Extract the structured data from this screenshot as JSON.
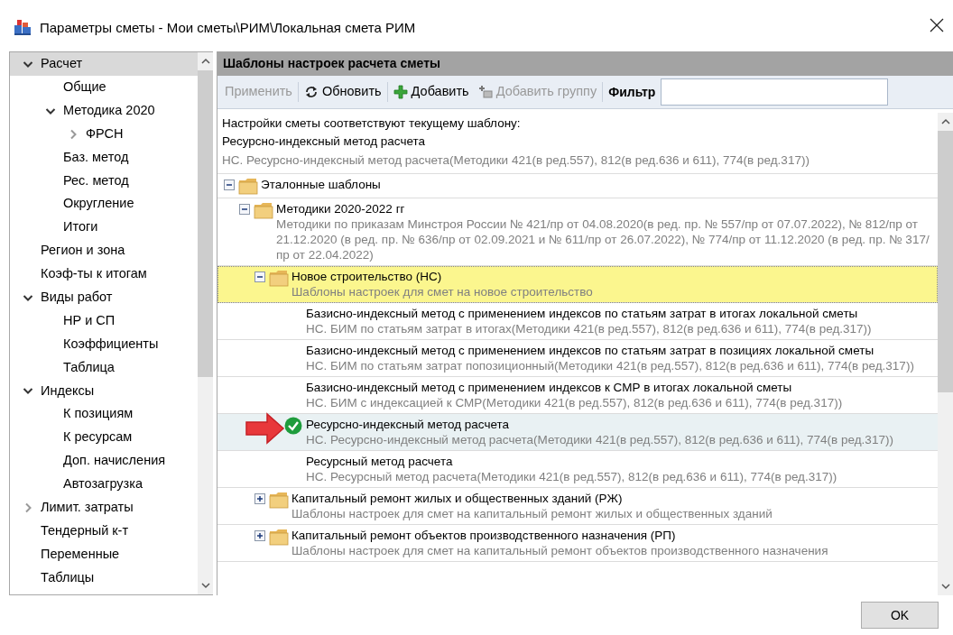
{
  "window": {
    "title": "Параметры сметы - Мои сметы\\РИМ\\Локальная смета РИМ"
  },
  "sidebar": {
    "items": [
      {
        "label": "Расчет",
        "selected": true,
        "expanded": true,
        "children": [
          {
            "label": "Общие",
            "selected": false
          },
          {
            "label": "Методика 2020",
            "selected": false,
            "expanded": true,
            "children": [
              {
                "label": "ФРСН",
                "selected": false,
                "expanded": false
              }
            ]
          },
          {
            "label": "Баз. метод",
            "selected": false
          },
          {
            "label": "Рес. метод",
            "selected": false
          },
          {
            "label": "Округление",
            "selected": false
          },
          {
            "label": "Итоги",
            "selected": false
          }
        ]
      },
      {
        "label": "Регион и зона",
        "selected": false
      },
      {
        "label": "Коэф-ты к итогам",
        "selected": false
      },
      {
        "label": "Виды работ",
        "selected": false,
        "expanded": true,
        "children": [
          {
            "label": "НР и СП",
            "selected": false
          },
          {
            "label": "Коэффициенты",
            "selected": false
          },
          {
            "label": "Таблица",
            "selected": false
          }
        ]
      },
      {
        "label": "Индексы",
        "selected": false,
        "expanded": true,
        "children": [
          {
            "label": "К позициям",
            "selected": false
          },
          {
            "label": "К ресурсам",
            "selected": false
          },
          {
            "label": "Доп. начисления",
            "selected": false
          },
          {
            "label": "Автозагрузка",
            "selected": false
          }
        ]
      },
      {
        "label": "Лимит. затраты",
        "selected": false,
        "expanded": false
      },
      {
        "label": "Тендерный к-т",
        "selected": false
      },
      {
        "label": "Переменные",
        "selected": false
      },
      {
        "label": "Таблицы",
        "selected": false
      }
    ]
  },
  "panel": {
    "title": "Шаблоны настроек расчета сметы",
    "toolbar": [
      {
        "kind": "plain",
        "label": "Применить",
        "disabled": true
      },
      {
        "kind": "refresh",
        "label": "Обновить",
        "disabled": false
      },
      {
        "kind": "add",
        "label": "Добавить",
        "disabled": false
      },
      {
        "kind": "addgroup",
        "label": "Добавить группу",
        "disabled": true
      },
      {
        "kind": "filter",
        "label": "Фильтр"
      }
    ],
    "info": {
      "label": "Настройки сметы соответствуют текущему шаблону:",
      "title": "Ресурсно-индексный метод расчета",
      "subtitle": "НС. Ресурсно-индексный метод расчета(Методики 421(в ред.557), 812(в ред.636 и 611), 774(в ред.317))"
    },
    "templates": [
      {
        "kind": "folder",
        "title": "Эталонные шаблоны",
        "expanded": true,
        "selected": false,
        "children": [
          {
            "kind": "folder",
            "title": "Методики 2020-2022 гг",
            "subtitle": "Методики по приказам Минстроя России № 421/пр от 04.08.2020(в ред. пр. № 557/пр от 07.07.2022), № 812/пр от 21.12.2020 (в ред. пр. № 636/пр от 02.09.2021 и № 611/пр от 26.07.2022), № 774/пр от 11.12.2020 (в ред. пр. № 317/пр от 22.04.2022)",
            "expanded": true,
            "selected": false,
            "children": [
              {
                "kind": "folder",
                "title": "Новое строительство (НС)",
                "subtitle": "Шаблоны настроек для смет на новое строительство",
                "expanded": true,
                "selected": true,
                "children": [
                  {
                    "kind": "template",
                    "title": "Базисно-индексный метод с применением индексов по статьям затрат в итогах локальной сметы",
                    "subtitle": "НС. БИМ по статьям затрат в итогах(Методики 421(в ред.557), 812(в ред.636 и 611), 774(в ред.317))",
                    "selected": false,
                    "current": false
                  },
                  {
                    "kind": "template",
                    "title": "Базисно-индексный метод с применением индексов по статьям затрат в позициях локальной сметы",
                    "subtitle": "НС. БИМ по статьям затрат попозиционный(Методики 421(в ред.557), 812(в ред.636 и 611), 774(в ред.317))",
                    "selected": false,
                    "current": false
                  },
                  {
                    "kind": "template",
                    "title": "Базисно-индексный метод с применением индексов к СМР в итогах локальной сметы",
                    "subtitle": "НС. БИМ с индексацией к СМР(Методики 421(в ред.557), 812(в ред.636 и 611), 774(в ред.317))",
                    "selected": false,
                    "current": false
                  },
                  {
                    "kind": "template",
                    "title": "Ресурсно-индексный метод расчета",
                    "subtitle": "НС. Ресурсно-индексный метод расчета(Методики 421(в ред.557), 812(в ред.636 и 611), 774(в ред.317))",
                    "selected": false,
                    "current": true
                  },
                  {
                    "kind": "template",
                    "title": "Ресурсный метод расчета",
                    "subtitle": "НС. Ресурсный метод расчета(Методики 421(в ред.557), 812(в ред.636 и 611), 774(в ред.317))",
                    "selected": false,
                    "current": false
                  }
                ]
              },
              {
                "kind": "folder",
                "title": "Капитальный ремонт жилых и общественных зданий (РЖ)",
                "subtitle": "Шаблоны настроек для смет на капитальный ремонт жилых и общественных зданий",
                "expanded": false,
                "selected": false
              },
              {
                "kind": "folder",
                "title": "Капитальный ремонт объектов производственного назначения (РП)",
                "subtitle": "Шаблоны настроек для смет на капитальный ремонт объектов производственного назначения",
                "expanded": false,
                "selected": false
              }
            ]
          }
        ]
      }
    ]
  },
  "buttons": [
    {
      "label": "OK"
    }
  ]
}
